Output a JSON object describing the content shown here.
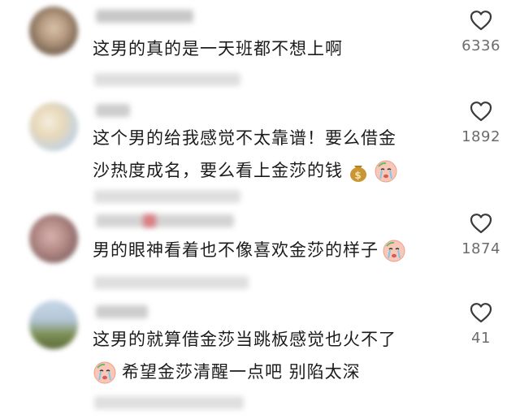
{
  "comments": [
    {
      "lines": [
        "这男的真的是一天班都不想上啊"
      ],
      "likes": "6336"
    },
    {
      "lines": [
        "这个男的给我感觉不太靠谱！要么借金",
        "沙热度成名，要么看上金莎的钱"
      ],
      "likes": "1892",
      "emojis": [
        "money-bag-emoji",
        "crying-face-emoji"
      ]
    },
    {
      "lines": [
        "男的眼神看着也不像喜欢金莎的样子"
      ],
      "likes": "1874",
      "emojis": [
        "crying-face-emoji"
      ]
    },
    {
      "lines": [
        "这男的就算借金莎当跳板感觉也火不了",
        "希望金莎清醒一点吧 别陷太深"
      ],
      "likes": "41",
      "emojis": [
        "crying-face-emoji"
      ]
    }
  ],
  "icons": {
    "like": "heart-outline-icon"
  },
  "colors": {
    "text": "#1c1c1c",
    "count": "#6c6c6c",
    "heart": "#3a3a3a"
  }
}
